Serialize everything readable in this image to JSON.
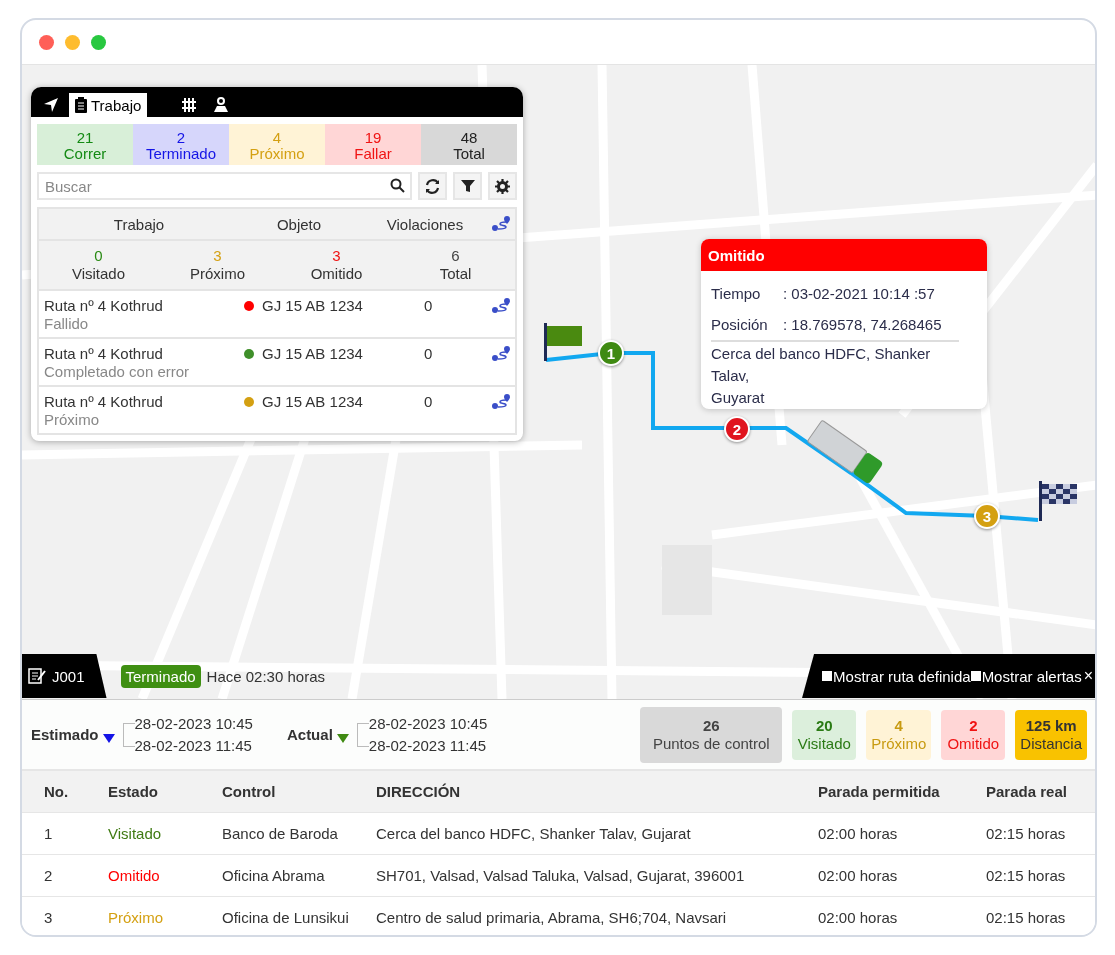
{
  "panel": {
    "tabs": [
      {
        "kind": "navigation",
        "selected": false
      },
      {
        "kind": "clipboard",
        "label": "Trabajo",
        "selected": true
      },
      {
        "kind": "grid",
        "selected": false
      },
      {
        "kind": "map-person",
        "selected": false
      }
    ],
    "counters": [
      {
        "kind": "running",
        "value": "21",
        "label": "Correr"
      },
      {
        "kind": "finished",
        "value": "2",
        "label": "Terminado"
      },
      {
        "kind": "upcoming",
        "value": "4",
        "label": "Próximo"
      },
      {
        "kind": "failed",
        "value": "19",
        "label": "Fallar"
      },
      {
        "kind": "total",
        "value": "48",
        "label": "Total"
      }
    ],
    "search": {
      "placeholder": "Buscar"
    },
    "columns": [
      "Trabajo",
      "Objeto",
      "Violaciones"
    ],
    "summary": [
      {
        "kind": "visited",
        "value": "0",
        "label": "Visitado"
      },
      {
        "kind": "upcoming",
        "value": "3",
        "label": "Próximo"
      },
      {
        "kind": "skipped",
        "value": "3",
        "label": "Omitido"
      },
      {
        "kind": "total",
        "value": "6",
        "label": "Total"
      }
    ],
    "jobs": [
      {
        "name": "Ruta nº 4 Kothrud",
        "status": "Fallido",
        "color": "#ff0000",
        "object": "GJ 15 AB 1234",
        "violations": "0"
      },
      {
        "name": "Ruta nº 4 Kothrud",
        "status": "Completado con error",
        "color": "#3f8f2a",
        "object": "GJ 15 AB 1234",
        "violations": "0"
      },
      {
        "name": "Ruta nº 4 Kothrud",
        "status": "Próximo",
        "color": "#d4a012",
        "object": "GJ 15 AB 1234",
        "violations": "0"
      }
    ]
  },
  "map": {
    "markers": [
      {
        "label": "1",
        "color": "#3f8a12"
      },
      {
        "label": "2",
        "color": "#e0141e"
      },
      {
        "label": "3",
        "color": "#d4a012"
      }
    ],
    "popup": {
      "title": "Omitido",
      "rows": [
        {
          "label": "Tiempo",
          "value": ": 03-02-2021 10:14 :57"
        },
        {
          "label": "Posición",
          "value": ": 18.769578, 74.268465"
        }
      ],
      "address": "Cerca del banco HDFC, Shanker Talav,\nGuyarat"
    }
  },
  "job_bar": {
    "id": "J001",
    "status": "Terminado",
    "ago": "Hace 02:30 horas",
    "options": [
      {
        "label": "Mostrar ruta definida",
        "checked": false
      },
      {
        "label": "Mostrar alertas",
        "checked": false
      }
    ],
    "close": "×"
  },
  "times": [
    {
      "kind": "estimated",
      "label": "Estimado",
      "start": "28-02-2023 10:45",
      "end": "28-02-2023 11:45"
    },
    {
      "kind": "actual",
      "label": "Actual",
      "start": "28-02-2023 10:45",
      "end": "28-02-2023 11:45"
    }
  ],
  "stats": [
    {
      "kind": "checkpoints",
      "value": "26",
      "label": "Puntos de control"
    },
    {
      "kind": "visited",
      "value": "20",
      "label": "Visitado"
    },
    {
      "kind": "upcoming",
      "value": "4",
      "label": "Próximo"
    },
    {
      "kind": "skipped",
      "value": "2",
      "label": "Omitido"
    },
    {
      "kind": "distance",
      "value": "125 km",
      "label": "Distancia"
    }
  ],
  "table": {
    "columns": [
      "No.",
      "Estado",
      "Control",
      "DIRECCIÓN",
      "Parada permitida",
      "Parada real"
    ],
    "rows": [
      {
        "no": "1",
        "status": "Visitado",
        "color": "#3f7a12",
        "control": "Banco de Baroda",
        "address": "Cerca del banco HDFC, Shanker Talav, Gujarat",
        "allowed": "02:00 horas",
        "actual": "02:15 horas"
      },
      {
        "no": "2",
        "status": "Omitido",
        "color": "#ff0000",
        "control": "Oficina Abrama",
        "address": "SH701, Valsad, Valsad Taluka, Valsad, Gujarat, 396001",
        "allowed": "02:00 horas",
        "actual": "02:15 horas"
      },
      {
        "no": "3",
        "status": "Próximo",
        "color": "#d4a012",
        "control": "Oficina de Lunsikui",
        "address": "Centro de salud primaria, Abrama, SH6;704, Navsari",
        "allowed": "02:00 horas",
        "actual": "02:15 horas"
      }
    ]
  }
}
